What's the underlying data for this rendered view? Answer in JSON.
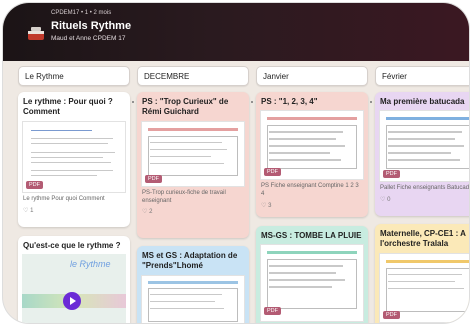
{
  "header": {
    "breadcrumb": "CPDEM17 • 1 • 2 mois",
    "title": "Rituels Rythme",
    "subtitle": "Maud et Anne CPDEM 17"
  },
  "columns": [
    {
      "title": "Le Rythme",
      "cards": [
        {
          "title": "Le rythme : Pour quoi ? Comment",
          "badge": "PDF",
          "caption": "Le rythme Pour quoi Comment",
          "likes": "1",
          "color": "#ffffff"
        },
        {
          "title": "Qu'est-ce que le rythme ?",
          "video_word": "le Rythme",
          "color": "#ffffff"
        }
      ]
    },
    {
      "title": "DECEMBRE",
      "cards": [
        {
          "title": "PS : \"Trop Curieux\" de Rémi Guichard",
          "badge": "PDF",
          "caption": "PS-Trop curieux-fiche de travail enseignant",
          "likes": "2",
          "color": "#f6d6d0"
        },
        {
          "title": "MS et GS : Adaptation de \"Prends\"Lhomé",
          "color": "#c9e3f5"
        }
      ]
    },
    {
      "title": "Janvier",
      "cards": [
        {
          "title": "PS : \"1, 2, 3, 4\"",
          "badge": "PDF",
          "caption": "PS Fiche enseignant Comptine 1 2 3 4",
          "likes": "3",
          "color": "#f6d6d0"
        },
        {
          "title": "MS-GS : TOMBE LA PLUIE",
          "badge": "PDF",
          "color": "#c8ece0"
        }
      ]
    },
    {
      "title": "Février",
      "cards": [
        {
          "title": "Ma première batucada",
          "badge": "PDF",
          "caption": "Pallet Fiche enseignants Batucada",
          "likes": "0",
          "color": "#e8d6f2"
        },
        {
          "title": "Maternelle, CP-CE1 : A l'orchestre Tralala",
          "badge": "PDF",
          "color": "#fbe9b8"
        }
      ]
    }
  ],
  "colors": {
    "header_bg": "#1b1416",
    "board_bg": "#efe9e3",
    "badge": "#b35b73"
  }
}
